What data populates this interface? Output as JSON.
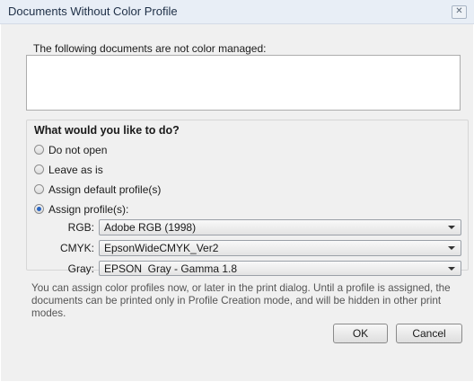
{
  "window": {
    "title": "Documents Without Color Profile",
    "close_glyph": "✕"
  },
  "documents": {
    "caption": "The following documents are not color managed:",
    "items": []
  },
  "options": {
    "heading": "What would you like to do?",
    "radios": [
      {
        "label": "Do not open",
        "checked": false
      },
      {
        "label": "Leave as is",
        "checked": false
      },
      {
        "label": "Assign default profile(s)",
        "checked": false
      },
      {
        "label": "Assign profile(s):",
        "checked": true
      }
    ],
    "profiles": {
      "rgb": {
        "label": "RGB:",
        "value": "Adobe RGB (1998)"
      },
      "cmyk": {
        "label": "CMYK:",
        "value": "EpsonWideCMYK_Ver2"
      },
      "gray": {
        "label": "Gray:",
        "value": "EPSON  Gray - Gamma 1.8"
      }
    }
  },
  "info_text": "You can assign color profiles now, or later in the print dialog. Until a profile is assigned, the documents can be printed only in Profile Creation mode, and will be hidden in other print modes.",
  "buttons": {
    "ok": "OK",
    "cancel": "Cancel"
  }
}
